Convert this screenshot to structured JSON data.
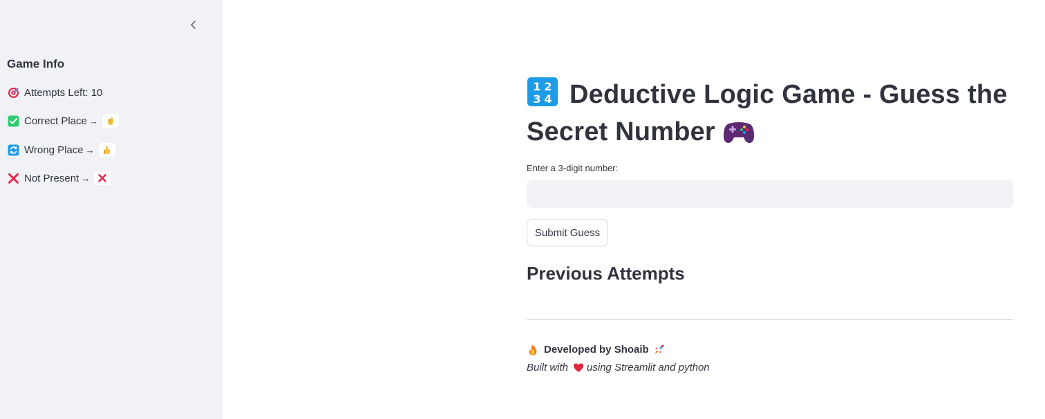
{
  "sidebar": {
    "heading": "Game Info",
    "items": [
      {
        "icon": "target-icon",
        "label": "Attempts Left: 10",
        "arrow": "",
        "chip_icon": ""
      },
      {
        "icon": "check-mark-button-icon",
        "label": "Correct Place",
        "arrow": "→",
        "chip_icon": "ok-hand-icon"
      },
      {
        "icon": "arrows-cycle-icon",
        "label": "Wrong Place",
        "arrow": "→",
        "chip_icon": "thumbs-up-icon"
      },
      {
        "icon": "cross-mark-icon",
        "label": "Not Present",
        "arrow": "→",
        "chip_icon": "cross-mark-icon"
      }
    ]
  },
  "main": {
    "title": "Deductive Logic Game - Guess the Secret Number",
    "title_icon_left": "input-numbers-icon",
    "title_icon_right": "game-controller-icon",
    "input_label": "Enter a 3-digit number:",
    "input_value": "",
    "submit_label": "Submit Guess",
    "previous_heading": "Previous Attempts",
    "developed_by": "Developed by Shoaib",
    "built_prefix": "Built with",
    "built_suffix": "using Streamlit and python"
  },
  "colors": {
    "sidebar_bg": "#f0f2f6",
    "text": "#31333f",
    "input_bg": "#f0f2f6",
    "blue_icon": "#1e9be6",
    "green_check": "#2ecc71",
    "red_cross": "#e8264b",
    "heart": "#e0243c",
    "controller": "#5b2a72"
  }
}
